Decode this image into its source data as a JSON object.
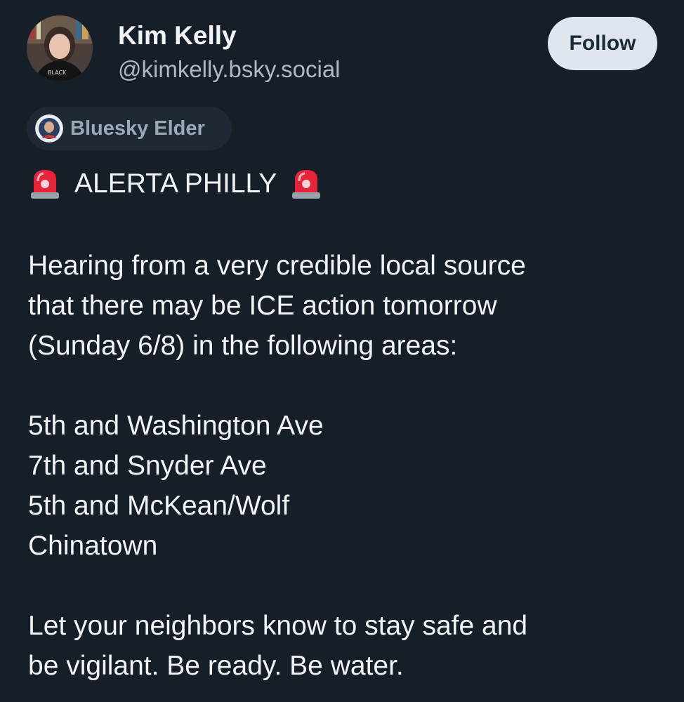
{
  "profile": {
    "display_name": "Kim Kelly",
    "handle": "@kimkelly.bsky.social",
    "follow_label": "Follow",
    "badge_label": "Bluesky Elder"
  },
  "post": {
    "alert_title": "ALERTA PHILLY",
    "alert_icon": "police-car-light-icon",
    "paragraph1": [
      "Hearing from a very credible local source",
      "that there may be ICE action tomorrow",
      "(Sunday 6/8) in the following areas:"
    ],
    "locations": [
      "5th and Washington Ave",
      "7th and Snyder Ave",
      "5th and McKean/Wolf",
      "Chinatown"
    ],
    "paragraph2": [
      "Let your neighbors know to stay safe and",
      "be vigilant. Be ready. Be water."
    ]
  },
  "colors": {
    "background": "#161e27",
    "text": "#f1f3f5",
    "handle": "#aeb9c6",
    "follow_button_bg": "#dfe6ee",
    "badge_bg": "#1f2935",
    "badge_text": "#9aa8b8"
  }
}
